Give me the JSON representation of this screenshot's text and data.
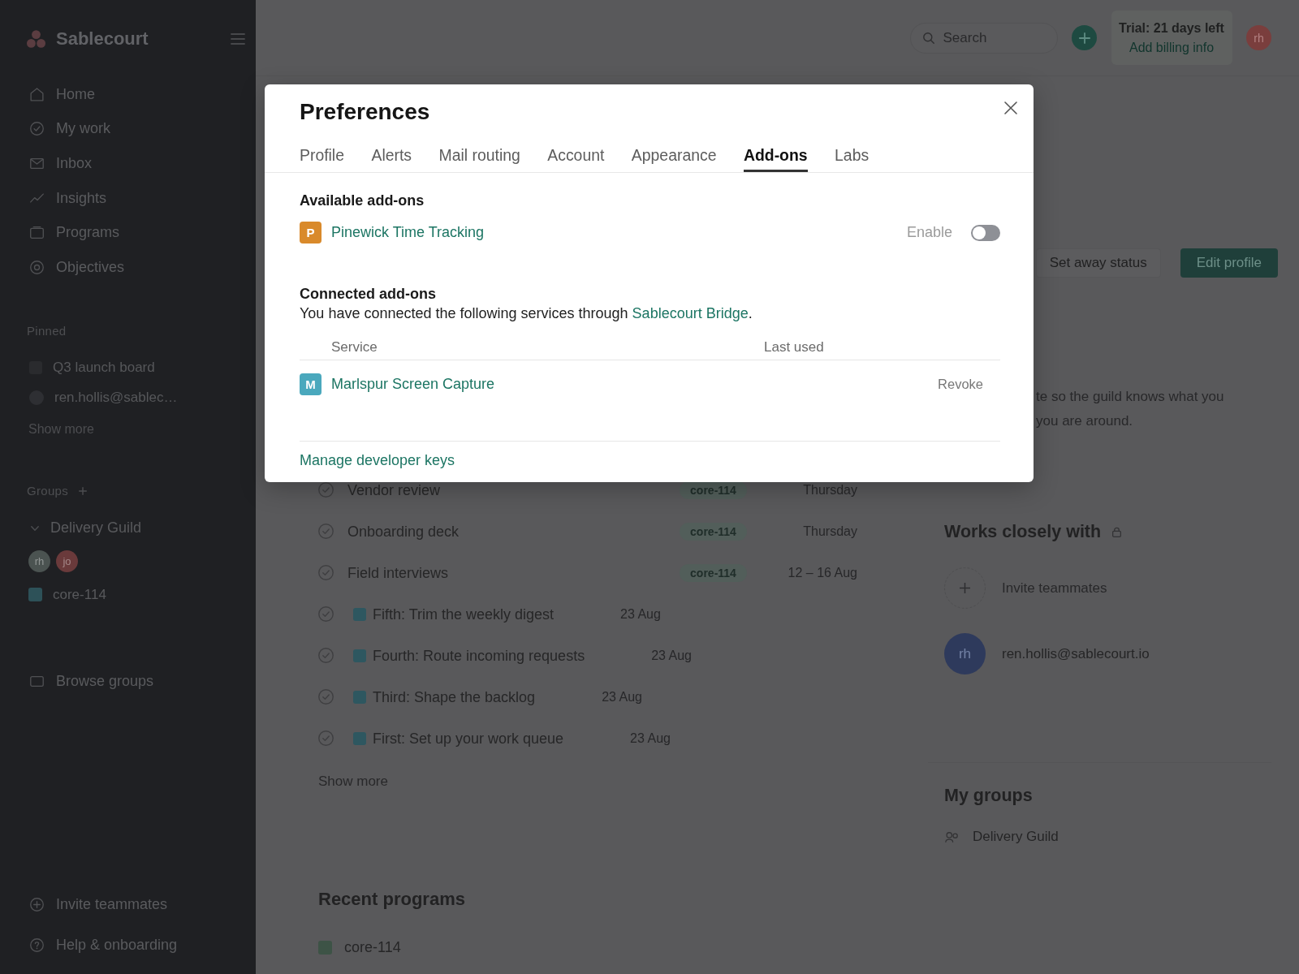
{
  "sidebar": {
    "brand": "Sablecourt",
    "nav": [
      {
        "label": "Home"
      },
      {
        "label": "My work"
      },
      {
        "label": "Inbox"
      },
      {
        "label": "Insights"
      },
      {
        "label": "Programs"
      },
      {
        "label": "Objectives"
      }
    ],
    "pinned": {
      "title": "Pinned",
      "items": [
        {
          "kind": "project",
          "label": "Q3 launch board"
        },
        {
          "kind": "person",
          "label": "ren.hollis@sablec…"
        }
      ],
      "show_more": "Show more"
    },
    "groups": {
      "title": "Groups",
      "items": [
        {
          "name": "Delivery Guild",
          "expanded": true,
          "members": [
            {
              "initials": "rh",
              "color": "#4b5351"
            },
            {
              "initials": "jo",
              "color": "#6a3a3b"
            }
          ],
          "projects": [
            {
              "name": "core-114"
            }
          ]
        }
      ],
      "browse": "Browse groups"
    },
    "footer": [
      {
        "label": "Invite teammates"
      },
      {
        "label": "Help & onboarding"
      }
    ]
  },
  "topbar": {
    "search": {
      "placeholder": "Search"
    },
    "trial": {
      "title": "Trial: 21 days left",
      "link": "Add billing info"
    },
    "avatar": "rh"
  },
  "profile": {
    "actions": [
      {
        "kind": "secondary",
        "label": "Set away status"
      },
      {
        "kind": "primary",
        "label": "Edit profile"
      }
    ],
    "note_lines": [
      "te so the guild knows what you",
      "you are around."
    ]
  },
  "tasks": {
    "rows": [
      {
        "kind": "task",
        "title": "Vendor review",
        "tag": "core-114",
        "date": "Thursday"
      },
      {
        "kind": "task",
        "title": "Onboarding deck",
        "tag": "core-114",
        "date": "Thursday"
      },
      {
        "kind": "task",
        "title": "Field interviews",
        "tag": "core-114",
        "date": "12 – 16 Aug"
      },
      {
        "kind": "subtask",
        "title": "Fifth: Trim the weekly digest",
        "date": "23 Aug"
      },
      {
        "kind": "subtask",
        "title": "Fourth: Route incoming requests",
        "date": "23 Aug"
      },
      {
        "kind": "subtask",
        "title": "Third: Shape the backlog",
        "date": "23 Aug"
      },
      {
        "kind": "subtask",
        "title": "First: Set up your work queue",
        "date": "23 Aug"
      }
    ],
    "show_more": "Show more"
  },
  "recent_programs": {
    "title": "Recent programs",
    "items": [
      {
        "name": "core-114"
      }
    ]
  },
  "works_with": {
    "title": "Works closely with",
    "invite": "Invite teammates",
    "people": [
      {
        "initials": "rh",
        "email": "ren.hollis@sablecourt.io"
      }
    ]
  },
  "my_groups": {
    "title": "My groups",
    "items": [
      {
        "name": "Delivery Guild"
      }
    ]
  },
  "modal": {
    "title": "Preferences",
    "tabs": [
      {
        "label": "Profile",
        "selected": false
      },
      {
        "label": "Alerts",
        "selected": false
      },
      {
        "label": "Mail routing",
        "selected": false
      },
      {
        "label": "Account",
        "selected": false
      },
      {
        "label": "Appearance",
        "selected": false
      },
      {
        "label": "Add-ons",
        "selected": true
      },
      {
        "label": "Labs",
        "selected": false
      }
    ],
    "available": {
      "title": "Available add-ons",
      "items": [
        {
          "initial": "P",
          "name": "Pinewick Time Tracking",
          "color": "#d98a2b",
          "toggle_label": "Enable",
          "enabled": false
        }
      ]
    },
    "connected": {
      "title": "Connected add-ons",
      "description": {
        "before": "You have connected the following services through ",
        "link": "Sablecourt Bridge",
        "after": "."
      },
      "columns": [
        "Service",
        "Last used"
      ],
      "rows": [
        {
          "initial": "M",
          "name": "Marlspur Screen Capture",
          "color": "#4aa8bd",
          "action": "Revoke"
        }
      ]
    },
    "footer_link": "Manage developer keys"
  }
}
